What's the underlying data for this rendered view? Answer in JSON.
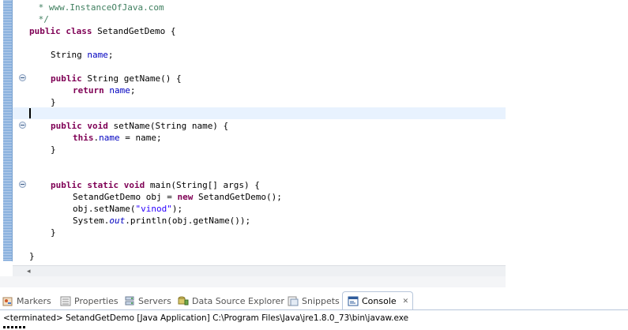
{
  "editor": {
    "comment_lines": [
      " * www.InstanceOfJava.com",
      " */"
    ],
    "code": {
      "class_decl": {
        "kw": "public class",
        "rest": " SetandGetDemo {"
      },
      "field": {
        "type": "String ",
        "name": "name",
        "end": ";"
      },
      "getter_sig": {
        "kw": "public",
        "rest": " String getName() {"
      },
      "getter_body": {
        "kw": "return",
        "sp": " ",
        "name": "name",
        "end": ";"
      },
      "close_brace": "}",
      "setter_sig": {
        "kw": "public void",
        "rest": " setName(String name) {"
      },
      "setter_body": {
        "kw": "this",
        "dot": ".",
        "name": "name",
        "rest": " = name;"
      },
      "main_sig": {
        "kw": "public static void",
        "rest": " main(String[] args) {"
      },
      "main_line1": {
        "pre": "SetandGetDemo obj = ",
        "kw": "new",
        "rest": " SetandGetDemo();"
      },
      "main_line2": {
        "pre": "obj.setName(",
        "str": "\"vinod\"",
        "rest": ");"
      },
      "main_line3": {
        "pre": "System.",
        "out": "out",
        "rest": ".println(obj.getName());"
      }
    },
    "hscroll_left_arrow": "◂"
  },
  "panel": {
    "tabs": [
      {
        "label": "Markers",
        "icon": "markers-icon"
      },
      {
        "label": "Properties",
        "icon": "properties-icon"
      },
      {
        "label": "Servers",
        "icon": "servers-icon"
      },
      {
        "label": "Data Source Explorer",
        "icon": "data-source-icon"
      },
      {
        "label": "Snippets",
        "icon": "snippets-icon"
      },
      {
        "label": "Console",
        "icon": "console-icon",
        "active": true,
        "close": "✕"
      }
    ],
    "status": "<terminated> SetandGetDemo [Java Application] C:\\Program Files\\Java\\jre1.8.0_73\\bin\\javaw.exe"
  }
}
